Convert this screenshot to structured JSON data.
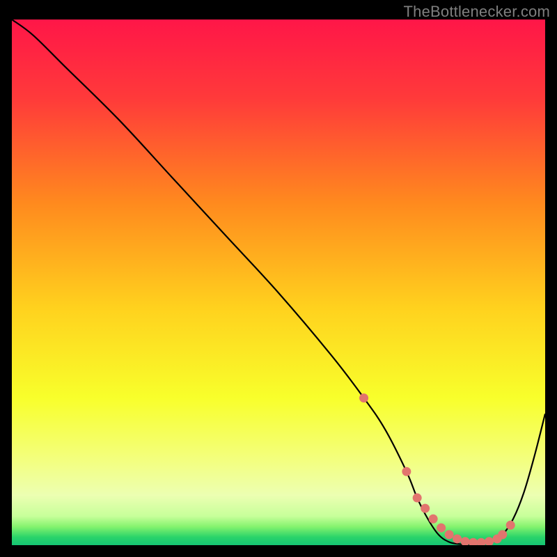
{
  "attribution": "TheBottlenecker.com",
  "chart_data": {
    "type": "line",
    "title": "",
    "xlabel": "",
    "ylabel": "",
    "xlim": [
      0,
      100
    ],
    "ylim": [
      0,
      100
    ],
    "x": [
      0,
      4,
      10,
      20,
      30,
      40,
      50,
      60,
      66,
      70,
      74,
      76,
      78,
      80,
      82,
      84,
      86,
      88,
      90,
      92,
      94,
      96,
      98,
      100
    ],
    "values": [
      100,
      97,
      91,
      81,
      70,
      59,
      48,
      36,
      28,
      22,
      14,
      9,
      5,
      2,
      0.6,
      0.2,
      0.2,
      0.4,
      0.8,
      2,
      5,
      10,
      17,
      25
    ],
    "marker_x": [
      66,
      74,
      76,
      77.5,
      79,
      80.5,
      82,
      83.5,
      85,
      86.5,
      88,
      89.5,
      91,
      92,
      93.5
    ],
    "marker_values": [
      28,
      14,
      9,
      7,
      5,
      3.3,
      2,
      1.2,
      0.7,
      0.5,
      0.5,
      0.7,
      1.2,
      2,
      3.8
    ],
    "gradient_stops": [
      {
        "offset": 0.0,
        "color": "#ff1648"
      },
      {
        "offset": 0.15,
        "color": "#ff3a3a"
      },
      {
        "offset": 0.35,
        "color": "#ff8a1e"
      },
      {
        "offset": 0.55,
        "color": "#ffd21e"
      },
      {
        "offset": 0.72,
        "color": "#f8ff2b"
      },
      {
        "offset": 0.84,
        "color": "#f3ff80"
      },
      {
        "offset": 0.905,
        "color": "#ecffb2"
      },
      {
        "offset": 0.945,
        "color": "#c7ff9a"
      },
      {
        "offset": 0.965,
        "color": "#84f36e"
      },
      {
        "offset": 0.985,
        "color": "#29d36a"
      },
      {
        "offset": 1.0,
        "color": "#15c574"
      }
    ],
    "curve_color": "#000000",
    "marker_color": "#e2746e"
  }
}
